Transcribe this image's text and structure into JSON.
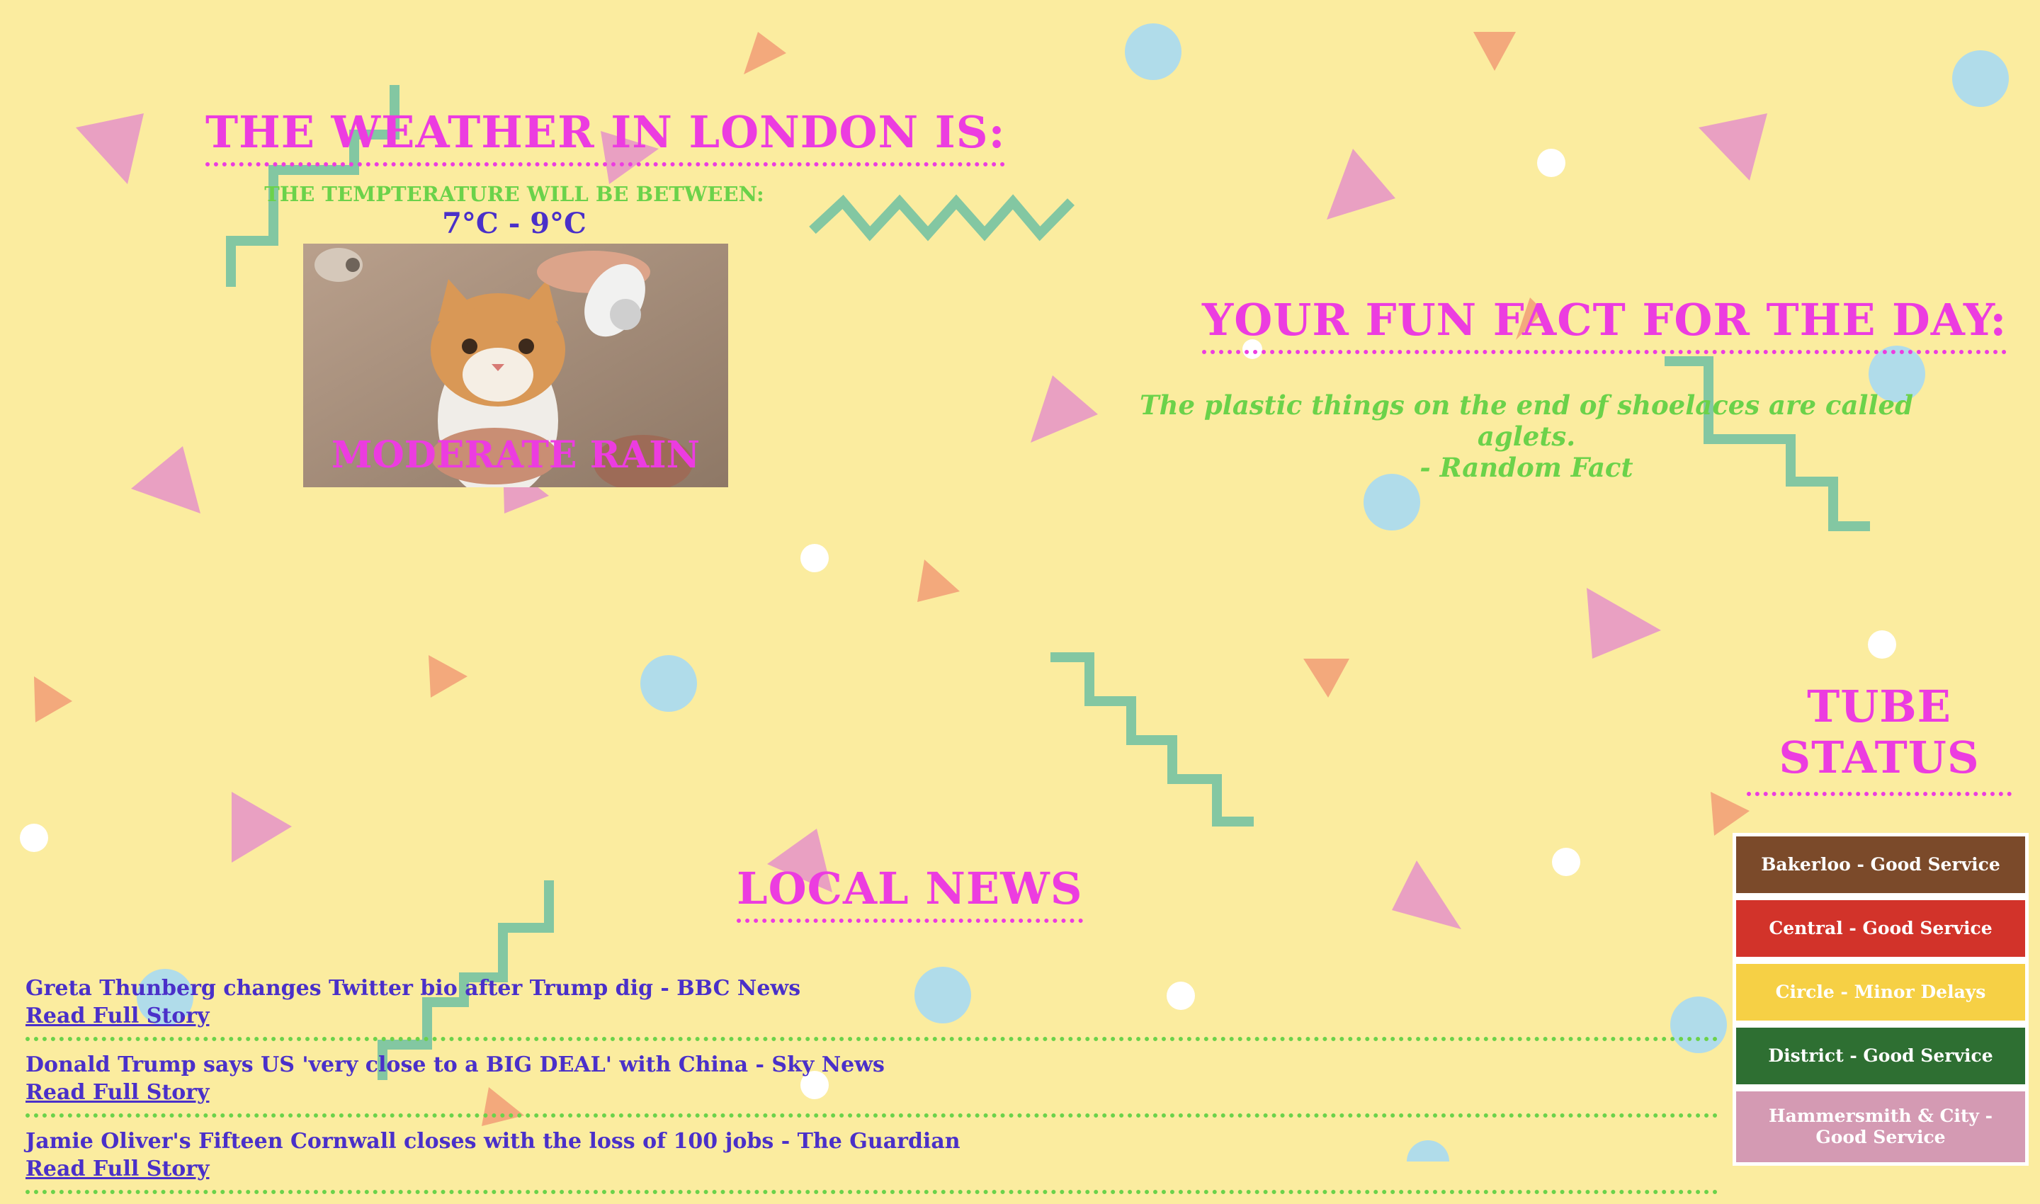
{
  "weather": {
    "heading": "THE WEATHER IN LONDON IS:",
    "temp_label": "THE TEMPTERATURE WILL BE BETWEEN:",
    "temp_range": "7°C - 9°C",
    "condition": "MODERATE RAIN",
    "photo_subject": "cat-being-showered"
  },
  "fun_fact": {
    "heading": "YOUR FUN FACT FOR THE DAY:",
    "text": "The plastic things on the end of shoelaces are called aglets.",
    "source": "- Random Fact"
  },
  "news": {
    "heading": "LOCAL NEWS",
    "items": [
      {
        "title": "Greta Thunberg changes Twitter bio after Trump dig - BBC News",
        "link": "Read Full Story"
      },
      {
        "title": "Donald Trump says US 'very close to a BIG DEAL' with China - Sky News",
        "link": "Read Full Story"
      },
      {
        "title": "Jamie Oliver's Fifteen Cornwall closes with the loss of 100 jobs - The Guardian",
        "link": "Read Full Story"
      }
    ]
  },
  "tube": {
    "heading": "TUBE STATUS",
    "lines": [
      {
        "label": "Bakerloo - Good Service",
        "color": "#7b4a2a"
      },
      {
        "label": "Central - Good Service",
        "color": "#d2332a"
      },
      {
        "label": "Circle - Minor Delays",
        "color": "#f6d045"
      },
      {
        "label": "District - Good Service",
        "color": "#2e6f32"
      },
      {
        "label": "Hammersmith & City - Good Service",
        "color": "#d49ab3"
      }
    ]
  },
  "colors": {
    "background": "#fbec9f",
    "heading": "#ec3ce0",
    "accent_green": "#6bd24a",
    "text_blue": "#4a30c9"
  }
}
